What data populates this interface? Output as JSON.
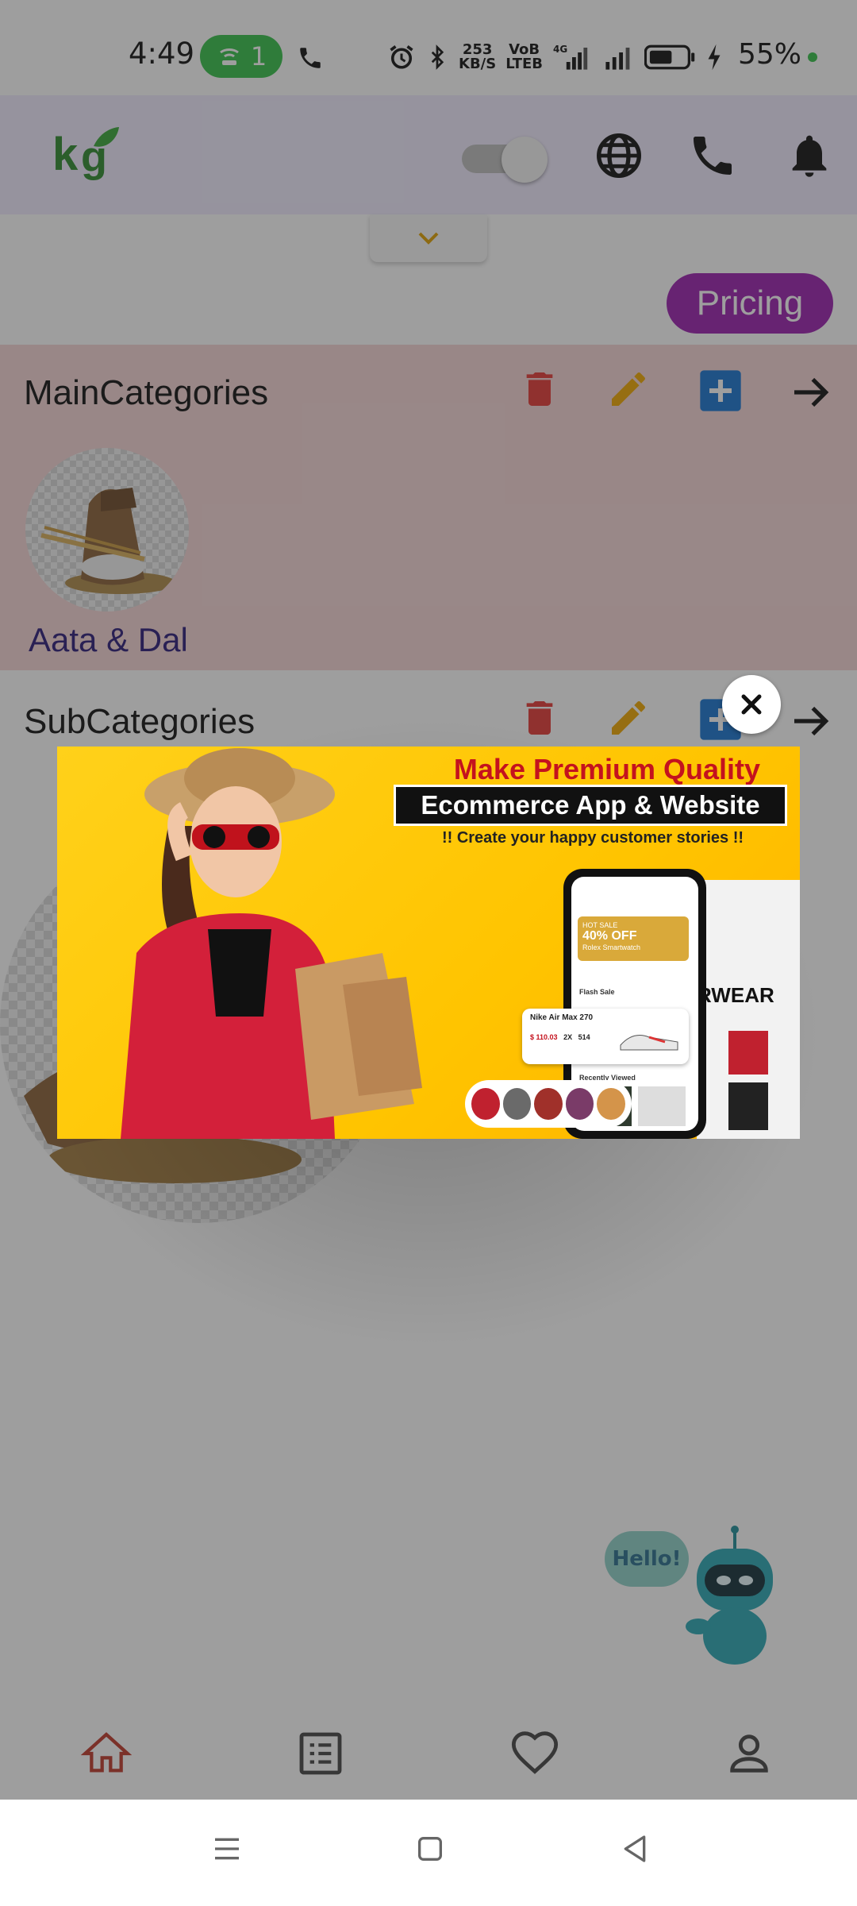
{
  "status_bar": {
    "time": "4:49",
    "hotspot_count": "1",
    "net_speed_value": "253",
    "net_speed_unit": "KB/S",
    "volte_top": "VoB",
    "volte_bottom": "LTEB",
    "network": "4G",
    "battery_percent": "55%"
  },
  "header": {
    "logo_text": "kg",
    "toggle_state": "off",
    "icons": [
      "globe-icon",
      "phone-icon",
      "bell-icon"
    ]
  },
  "pricing_label": "Pricing",
  "main_categories": {
    "title": "MainCategories",
    "items": [
      {
        "label": "Aata & Dal"
      }
    ]
  },
  "sub_categories": {
    "title": "SubCategories"
  },
  "ad": {
    "headline": "Make Premium Quality",
    "subheadline": "Ecommerce App & Website",
    "tagline": "!! Create your happy customer stories !!",
    "promo_title": "HOT SALE",
    "promo_value": "40% OFF",
    "promo_item": "Rolex Smartwatch",
    "flash_sale": "Flash Sale",
    "recently_viewed": "Recently Viewed",
    "product_name": "Nike Air Max 270",
    "product_price": "$ 110.03",
    "product_qty": "2X",
    "product_size": "514",
    "side_text": "RWEAR"
  },
  "chatbot": {
    "greeting": "Hello!"
  },
  "bottom_nav": [
    "home-icon",
    "list-icon",
    "heart-icon",
    "profile-icon"
  ],
  "colors": {
    "pricing": "#9b1fb0",
    "delete": "#e53935",
    "edit": "#f0a800",
    "add": "#1976d2",
    "home_active": "#c0392b"
  }
}
